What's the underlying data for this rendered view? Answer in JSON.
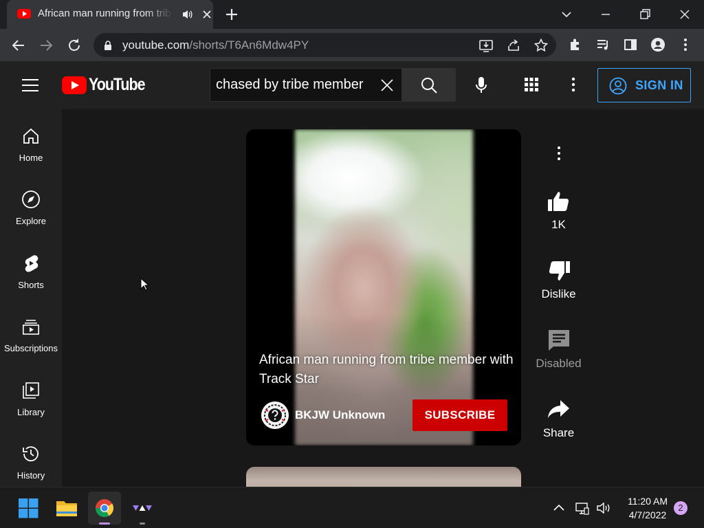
{
  "browser": {
    "tab": {
      "title": "African man running from tribe member with Track Star - YouTube"
    },
    "url": {
      "host": "youtube.com",
      "path": "/shorts/T6An6Mdw4PY"
    }
  },
  "youtube": {
    "logo_text": "YouTube",
    "search": {
      "value": "chased by tribe member",
      "placeholder": "Search"
    },
    "sign_in_label": "SIGN IN",
    "sidebar": [
      {
        "label": "Home",
        "icon": "home-icon"
      },
      {
        "label": "Explore",
        "icon": "compass-icon"
      },
      {
        "label": "Shorts",
        "icon": "shorts-icon"
      },
      {
        "label": "Subscriptions",
        "icon": "subscriptions-icon"
      },
      {
        "label": "Library",
        "icon": "library-icon"
      },
      {
        "label": "History",
        "icon": "history-icon"
      }
    ],
    "short": {
      "title": "African man running from tribe member with Track Star",
      "channel": "BKJW Unknown",
      "subscribe_label": "SUBSCRIBE"
    },
    "actions": {
      "like_count": "1K",
      "dislike_label": "Dislike",
      "comments_label": "Disabled",
      "share_label": "Share"
    },
    "colors": {
      "brand_red": "#ff0000",
      "subscribe_red": "#cc0000",
      "link_blue": "#3ea6ff"
    }
  },
  "taskbar": {
    "time": "11:20 AM",
    "date": "4/7/2022",
    "notification_count": "2"
  }
}
